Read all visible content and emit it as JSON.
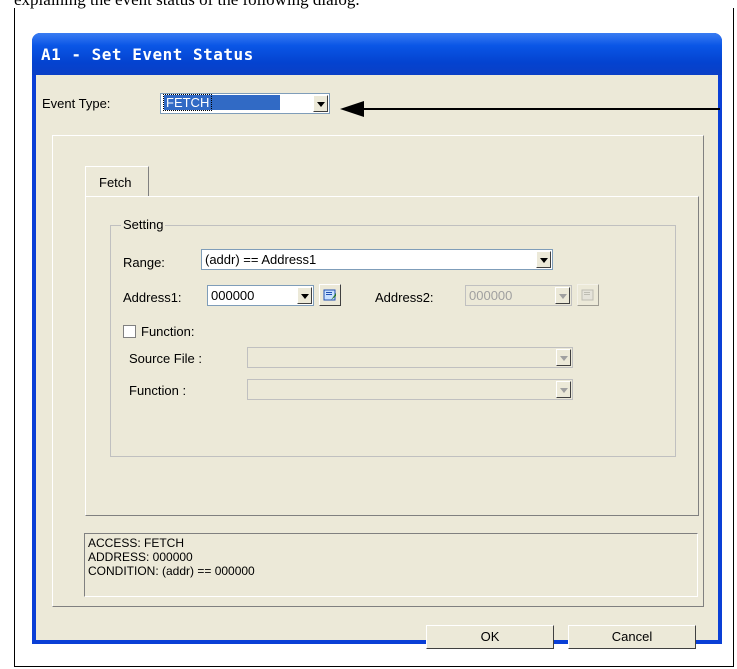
{
  "document": {
    "top_text": "explaining the event status of the following dialog."
  },
  "window": {
    "title": "A1 - Set Event Status"
  },
  "event_type": {
    "label": "Event Type:",
    "value": "FETCH"
  },
  "tabs": [
    {
      "label": "Fetch"
    }
  ],
  "setting": {
    "group_label": "Setting",
    "range_label": "Range:",
    "range_value": "(addr) == Address1",
    "address1_label": "Address1:",
    "address1_value": "000000",
    "address2_label": "Address2:",
    "address2_value": "000000",
    "function_checkbox_label": "Function:",
    "function_checked": false,
    "source_file_label": "Source File :",
    "source_file_value": "",
    "function_label": "Function :",
    "function_value": ""
  },
  "info": {
    "line1": "ACCESS: FETCH",
    "line2": "ADDRESS: 000000",
    "line3": "CONDITION: (addr) == 000000"
  },
  "buttons": {
    "ok": "OK",
    "cancel": "Cancel"
  },
  "colors": {
    "titlebar": "#0a56e6",
    "dialog_face": "#ece9d8",
    "selection": "#316ac5"
  }
}
